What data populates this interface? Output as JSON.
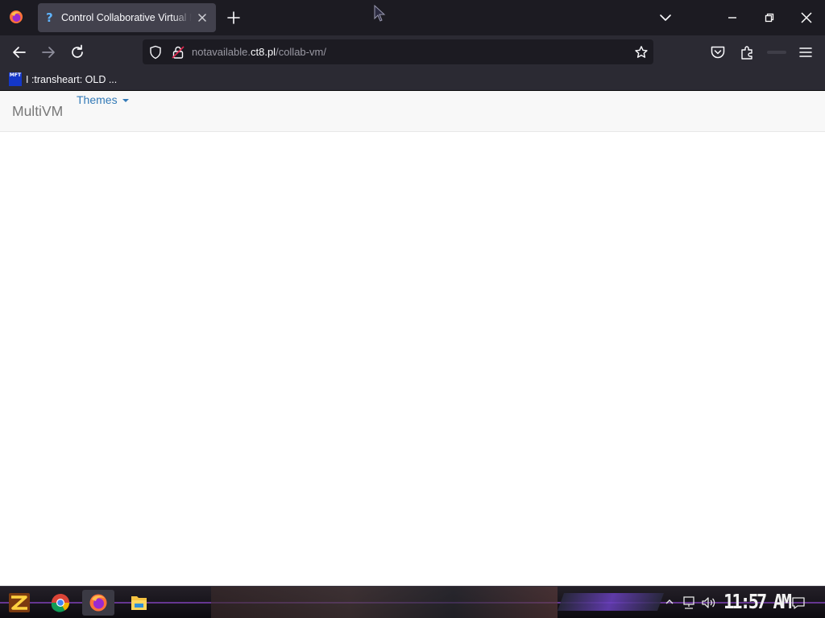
{
  "browser": {
    "tab": {
      "title": "Control Collaborative Virtual Machines!",
      "favicon_glyph": "?",
      "active": true
    },
    "url": {
      "prefix": "notavailable.",
      "host": "ct8.pl",
      "path": "/collab-vm/"
    },
    "bookmarks": [
      {
        "label": "I :transheart: OLD ...",
        "favicon_text": "MFT"
      }
    ],
    "colors": {
      "tabstrip_bg": "#1c1b22",
      "toolbar_bg": "#2b2a33",
      "active_tab_bg": "#42414d",
      "text": "#fbfbfe"
    }
  },
  "page": {
    "brand": "MultiVM",
    "themes_label": "Themes",
    "colors": {
      "navbar_bg": "#f8f8f8",
      "link": "#337ab7",
      "brand_text": "#777777"
    }
  },
  "taskbar": {
    "clock": "11:57 AM",
    "pinned_apps": [
      "chrome-icon",
      "firefox-icon",
      "file-explorer-icon"
    ],
    "active_app": "firefox-icon",
    "accent": "#7a3fb0"
  }
}
